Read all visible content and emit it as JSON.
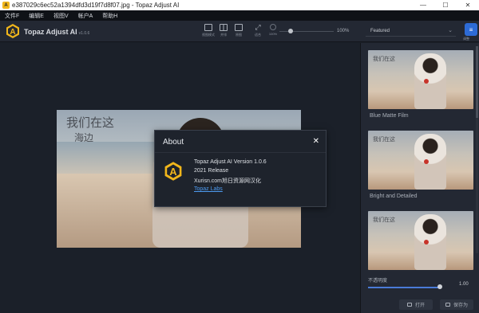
{
  "window": {
    "title": "e387029c6ec52a1394dfd3d19f7d8f07.jpg - Topaz Adjust AI",
    "app_icon_letter": "A",
    "minimize": "—",
    "maximize": "☐",
    "close": "✕"
  },
  "menu": [
    "文件F",
    "编辑E",
    "视图V",
    "帐户A",
    "帮助H"
  ],
  "toolbar": {
    "brand": "Topaz Adjust AI",
    "version": "v1.0.6",
    "tools": [
      {
        "label": "视图模式"
      },
      {
        "label": "并排"
      },
      {
        "label": "原图"
      },
      {
        "label": "适合"
      },
      {
        "label": "100%"
      }
    ],
    "zoom_value": "100%",
    "zoom_level": 0.16,
    "preset": "Featured",
    "settings_label": "调整"
  },
  "photo": {
    "calligraphy_line1": "我们在这",
    "calligraphy_line2": "海边"
  },
  "panel": {
    "presets": [
      {
        "label": "Blue Matte Film"
      },
      {
        "label": "Bright and Detailed"
      },
      {
        "label": ""
      }
    ],
    "opacity_label": "不透明度",
    "opacity_value": "1.00",
    "open_button": "打开",
    "save_button": "保存为"
  },
  "dialog": {
    "title": "About",
    "close": "✕",
    "version_line": "Topaz Adjust AI Version 1.0.6",
    "release_line": "2021 Release",
    "credit_line": "Xurisn.com旭日资源网汉化",
    "link": "Topaz Labs"
  },
  "colors": {
    "accent_gold": "#f1b61b",
    "link_blue": "#4d9bf0",
    "background": "#1b2029"
  }
}
